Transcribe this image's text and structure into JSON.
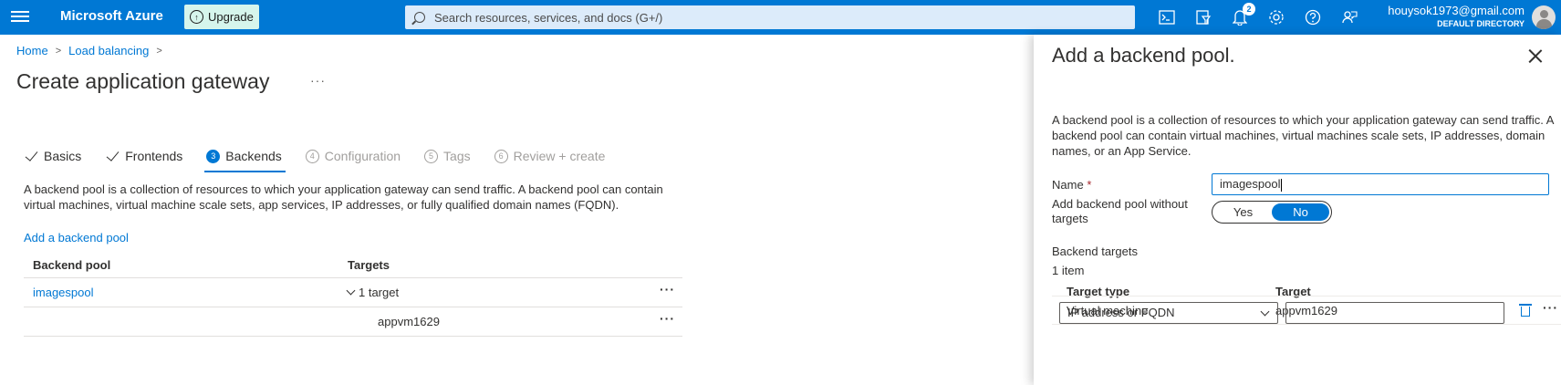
{
  "topbar": {
    "brand": "Microsoft Azure",
    "upgrade_label": "Upgrade",
    "search_placeholder": "Search resources, services, and docs (G+/)",
    "notification_count": "2",
    "account_email": "houysok1973@gmail.com",
    "account_directory": "DEFAULT DIRECTORY",
    "icons": [
      "cloud-shell-icon",
      "directory-filter-icon",
      "notifications-icon",
      "settings-icon",
      "help-icon",
      "feedback-icon"
    ]
  },
  "breadcrumb": {
    "items": [
      "Home",
      "Load balancing"
    ]
  },
  "page": {
    "title": "Create application gateway",
    "more": "···"
  },
  "tabs": [
    {
      "label": "Basics",
      "state": "completed"
    },
    {
      "label": "Frontends",
      "state": "completed"
    },
    {
      "number": "3",
      "label": "Backends",
      "state": "active"
    },
    {
      "number": "4",
      "label": "Configuration",
      "state": "disabled"
    },
    {
      "number": "5",
      "label": "Tags",
      "state": "disabled"
    },
    {
      "number": "6",
      "label": "Review + create",
      "state": "disabled"
    }
  ],
  "backends": {
    "description": "A backend pool is a collection of resources to which your application gateway can send traffic. A backend pool can contain virtual machines, virtual machine scale sets, app services, IP addresses, or fully qualified domain names (FQDN).",
    "add_link": "Add a backend pool",
    "columns": [
      "Backend pool",
      "Targets"
    ],
    "rows": [
      {
        "pool": "imagespool",
        "targets": "1 target",
        "more": "···"
      },
      {
        "pool": "",
        "targets": "appvm1629",
        "more": "···"
      }
    ]
  },
  "panel": {
    "title": "Add a backend pool.",
    "description": "A backend pool is a collection of resources to which your application gateway can send traffic. A backend pool can contain virtual machines, virtual machines scale sets, IP addresses, domain names, or an App Service.",
    "name_label": "Name",
    "required_mark": "*",
    "name_value": "imagespool",
    "no_targets_label": "Add backend pool without targets",
    "toggle": {
      "yes": "Yes",
      "no": "No",
      "selected": "No"
    },
    "backend_targets_label": "Backend targets",
    "item_count": "1 item",
    "target_columns": [
      "Target type",
      "Target"
    ],
    "target_rows": [
      {
        "type": "Virtual machine",
        "target": "appvm1629",
        "more": "···"
      }
    ],
    "new_target_type": "IP address or FQDN",
    "new_target_value": ""
  },
  "colors": {
    "accent": "#0078d4",
    "upgrade_bg": "#d6f5ec",
    "required": "#a4262c"
  }
}
